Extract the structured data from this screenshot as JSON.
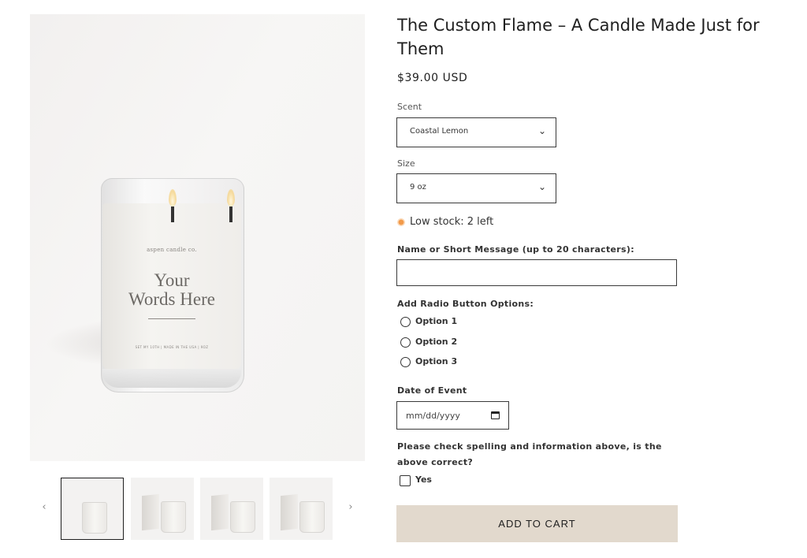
{
  "gallery": {
    "main_image": {
      "brand_text": "aspen candle co.",
      "label_line1": "Your",
      "label_line2": "Words Here",
      "small_print": "SET MY 10TH | MADE IN THE USA | 9OZ"
    },
    "thumbnails_count": 4,
    "active_thumbnail": 1,
    "prev_arrow": "‹",
    "next_arrow": "›"
  },
  "product": {
    "title": "The Custom Flame – A Candle Made Just for Them",
    "price": "$39.00 USD"
  },
  "options": {
    "scent": {
      "label": "Scent",
      "value": "Coastal Lemon"
    },
    "size": {
      "label": "Size",
      "value": "9 oz"
    },
    "stock_text": "Low stock: 2 left",
    "stock_color": "#f29a4a"
  },
  "custom_fields": {
    "message_label": "Name or Short Message (up to 20 characters):",
    "message_value": "",
    "radio_label": "Add Radio Button Options:",
    "radio_options": [
      "Option 1",
      "Option 2",
      "Option 3"
    ],
    "date_label": "Date of Event",
    "date_placeholder": "mm/dd/yyyy",
    "confirm_label": "Please check spelling and information above, is the above correct?",
    "confirm_option": "Yes"
  },
  "cart": {
    "button_label": "ADD TO CART",
    "button_color": "#e2d9cd"
  }
}
